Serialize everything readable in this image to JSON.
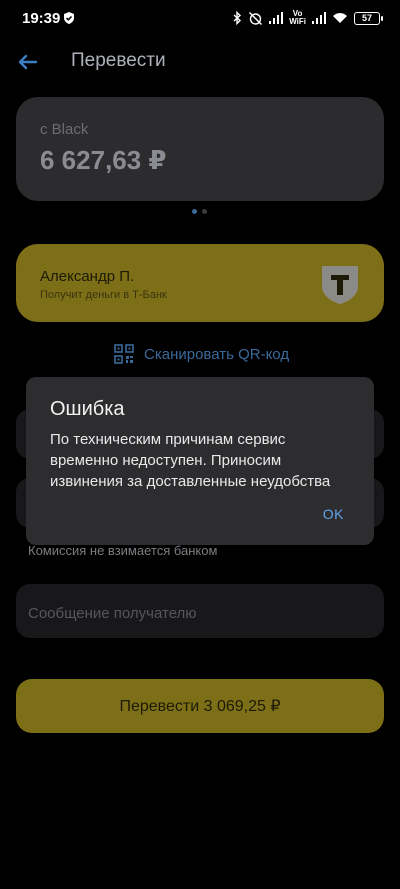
{
  "status_bar": {
    "time": "19:39",
    "battery": "57"
  },
  "header": {
    "title": "Перевести"
  },
  "account": {
    "label": "с Black",
    "balance": "6 627,63 ₽"
  },
  "recipient": {
    "name": "Александр П.",
    "subtitle": "Получит деньги в Т-Банк"
  },
  "scan": {
    "label": "Сканировать QR-код"
  },
  "commission": "Комиссия не взимается банком",
  "message_field": {
    "placeholder": "Сообщение получателю"
  },
  "transfer_button": {
    "label": "Перевести 3 069,25 ₽"
  },
  "dialog": {
    "title": "Ошибка",
    "message": "По техническим причинам сервис временно недоступен. Приносим извинения за доставленные неудобства",
    "ok_label": "OK"
  },
  "colors": {
    "accent_yellow": "#7d6f17",
    "link_blue": "#3a6a9a",
    "dialog_button": "#5fa4ea"
  },
  "icons": {
    "back": "arrow-left-icon",
    "qr": "qr-code-icon",
    "logo": "tbank-logo"
  }
}
